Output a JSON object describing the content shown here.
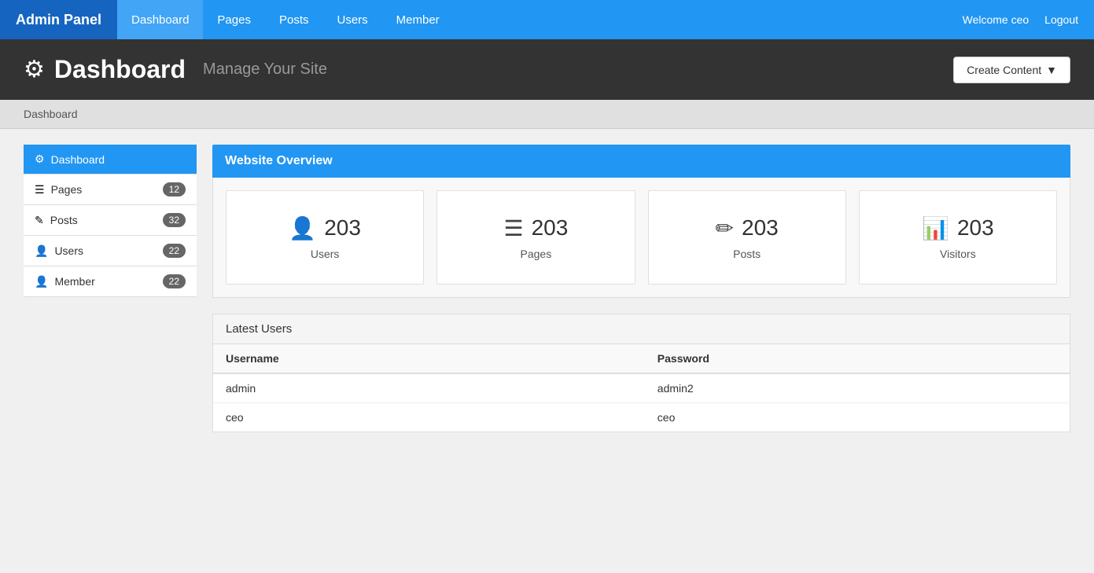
{
  "navbar": {
    "brand": "Admin Panel",
    "items": [
      {
        "label": "Dashboard",
        "active": true
      },
      {
        "label": "Pages"
      },
      {
        "label": "Posts"
      },
      {
        "label": "Users"
      },
      {
        "label": "Member"
      }
    ],
    "welcome_text": "Welcome ceo",
    "logout_label": "Logout"
  },
  "page_header": {
    "icon": "⚙",
    "title": "Dashboard",
    "subtitle": "Manage Your Site",
    "create_content_label": "Create Content",
    "create_content_arrow": "▼"
  },
  "breadcrumb": {
    "label": "Dashboard"
  },
  "sidebar": {
    "items": [
      {
        "label": "Dashboard",
        "icon": "⚙",
        "badge": null,
        "active": true
      },
      {
        "label": "Pages",
        "icon": "☰",
        "badge": "12"
      },
      {
        "label": "Posts",
        "icon": "✎",
        "badge": "32"
      },
      {
        "label": "Users",
        "icon": "👤",
        "badge": "22"
      },
      {
        "label": "Member",
        "icon": "👤",
        "badge": "22"
      }
    ]
  },
  "overview": {
    "title": "Website Overview",
    "stats": [
      {
        "icon": "👤",
        "number": "203",
        "label": "Users"
      },
      {
        "icon": "☰",
        "number": "203",
        "label": "Pages"
      },
      {
        "icon": "✏",
        "number": "203",
        "label": "Posts"
      },
      {
        "icon": "📊",
        "number": "203",
        "label": "Visitors"
      }
    ]
  },
  "latest_users": {
    "title": "Latest Users",
    "columns": [
      "Username",
      "Password"
    ],
    "rows": [
      {
        "username": "admin",
        "password": "admin2"
      },
      {
        "username": "ceo",
        "password": "ceo"
      }
    ]
  }
}
